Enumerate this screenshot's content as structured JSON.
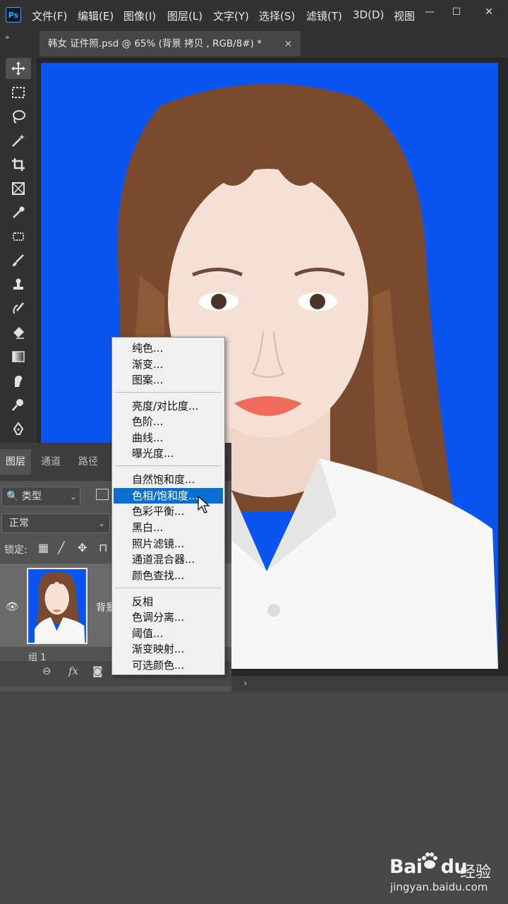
{
  "app": {
    "logo_text": "Ps"
  },
  "menu": {
    "items": [
      "文件(F)",
      "编辑(E)",
      "图像(I)",
      "图层(L)",
      "文字(Y)",
      "选择(S)",
      "滤镜(T)",
      "3D(D)",
      "视图"
    ]
  },
  "window": {
    "minimize": "—",
    "maximize": "☐",
    "close": "✕"
  },
  "tab": {
    "collapse": "»",
    "title": "韩女 证件照.psd @ 65% (背景 拷贝 , RGB/8#) *",
    "close": "×"
  },
  "toolbar": {
    "tools": [
      "move",
      "marquee",
      "lasso",
      "magic-wand",
      "crop",
      "frame",
      "eyedropper",
      "healing",
      "brush",
      "stamp",
      "history-brush",
      "eraser",
      "gradient",
      "smudge",
      "dodge",
      "pen"
    ]
  },
  "layers_panel": {
    "tabs": [
      "图层",
      "通道",
      "路径"
    ],
    "kind_filter": "类型",
    "blend_mode": "正常",
    "lock_label": "锁定:",
    "layer_name": "背景",
    "group_name": "组 1",
    "footer": {
      "link": "⊖",
      "fx": "fx"
    }
  },
  "context_menu": {
    "groups": [
      [
        "纯色...",
        "渐变...",
        "图案..."
      ],
      [
        "亮度/对比度...",
        "色阶...",
        "曲线...",
        "曝光度..."
      ],
      [
        "自然饱和度...",
        "色相/饱和度...",
        "色彩平衡...",
        "黑白...",
        "照片滤镜...",
        "通道混合器...",
        "颜色查找..."
      ],
      [
        "反相",
        "色调分离...",
        "阈值...",
        "渐变映射...",
        "可选颜色..."
      ]
    ],
    "highlighted": "色相/饱和度..."
  },
  "canvas": {
    "background_color": "#0a55f0"
  },
  "watermark": {
    "logo": "Bai",
    "logo_suffix": "du",
    "text": "经验",
    "url": "jingyan.baidu.com"
  }
}
